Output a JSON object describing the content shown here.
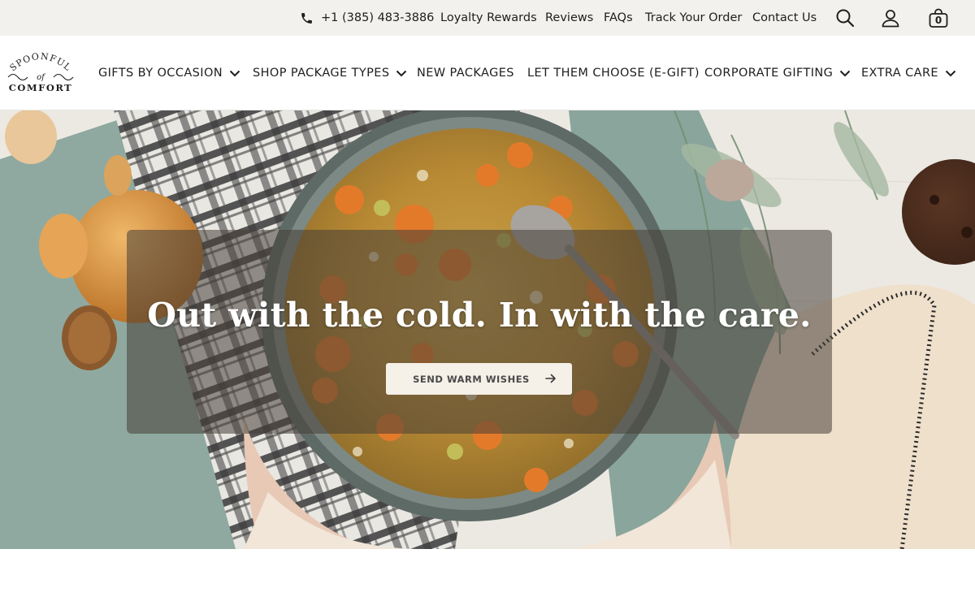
{
  "utility_bar": {
    "phone": "+1 (385) 483-3886",
    "links": [
      "Loyalty Rewards",
      "Reviews",
      "FAQs",
      "Track Your Order",
      "Contact Us"
    ],
    "cart_count": "0",
    "icons": [
      "phone-icon",
      "search-icon",
      "account-icon",
      "cart-icon"
    ]
  },
  "brand": {
    "logo_top": "SPOONFUL",
    "logo_bottom": "COMFORT",
    "logo_mark": "of"
  },
  "nav": {
    "items": [
      {
        "label": "GIFTS BY OCCASION",
        "dropdown": true
      },
      {
        "label": "SHOP PACKAGE TYPES",
        "dropdown": true
      },
      {
        "label": "NEW PACKAGES",
        "dropdown": false
      },
      {
        "label": "LET THEM CHOOSE (E-GIFT)",
        "dropdown": false
      },
      {
        "label": "CORPORATE GIFTING",
        "dropdown": true
      },
      {
        "label": "EXTRA CARE",
        "dropdown": true
      }
    ]
  },
  "hero": {
    "headline": "Out with the cold. In with the care.",
    "cta_label": "SEND WARM WISHES"
  },
  "colors": {
    "utility_bg": "#f2f1ee",
    "overlay": "#463e36",
    "button_bg": "#f5f0e8",
    "text": "#1e1e1e"
  }
}
